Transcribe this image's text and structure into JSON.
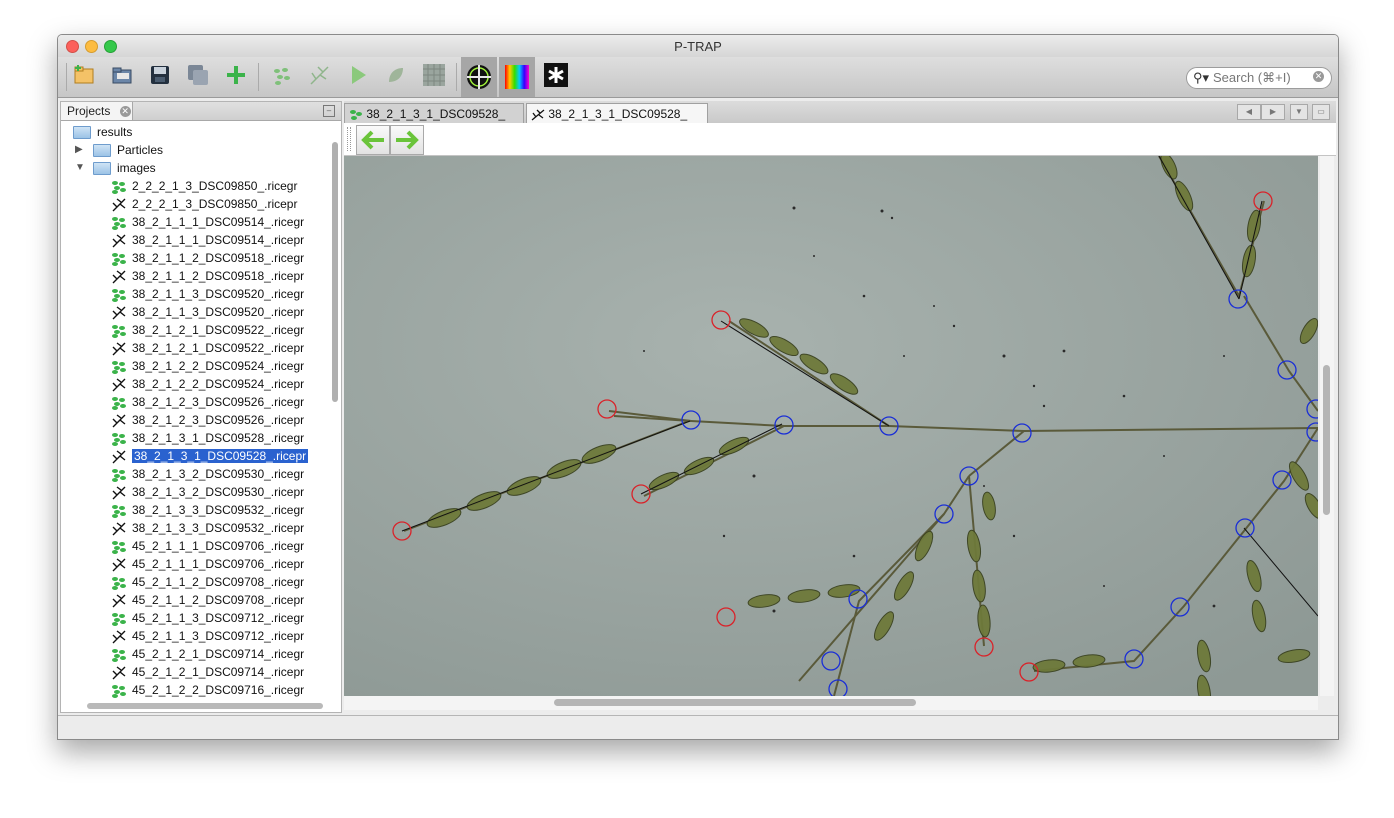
{
  "window": {
    "title": "P-TRAP"
  },
  "toolbar": {
    "buttons": [
      {
        "name": "new-project",
        "icon": "new-project-icon"
      },
      {
        "name": "open-project",
        "icon": "open-folder-icon"
      },
      {
        "name": "save",
        "icon": "save-icon"
      },
      {
        "name": "save-all",
        "icon": "save-all-icon"
      },
      {
        "name": "add",
        "icon": "plus-icon"
      },
      {
        "name": "detect-particles",
        "icon": "particles-icon"
      },
      {
        "name": "detect-skeleton",
        "icon": "skeleton-icon"
      },
      {
        "name": "run",
        "icon": "play-icon"
      },
      {
        "name": "leaf",
        "icon": "leaf-icon"
      },
      {
        "name": "grid",
        "icon": "grid-icon"
      },
      {
        "name": "crosshair",
        "icon": "crosshair-icon",
        "pressed": true
      },
      {
        "name": "color-spectrum",
        "icon": "spectrum-icon",
        "pressed": true
      },
      {
        "name": "asterisk",
        "icon": "asterisk-icon"
      }
    ],
    "search_placeholder": "Search (⌘+I)"
  },
  "left_panel": {
    "tab_label": "Projects",
    "tree": {
      "root": "results",
      "folders": [
        "Particles",
        "images"
      ],
      "files": [
        {
          "name": "2_2_2_1_3_DSC09850_.ricegr",
          "type": "gr"
        },
        {
          "name": "2_2_2_1_3_DSC09850_.ricepr",
          "type": "pr"
        },
        {
          "name": "38_2_1_1_1_DSC09514_.ricegr",
          "type": "gr"
        },
        {
          "name": "38_2_1_1_1_DSC09514_.ricepr",
          "type": "pr"
        },
        {
          "name": "38_2_1_1_2_DSC09518_.ricegr",
          "type": "gr"
        },
        {
          "name": "38_2_1_1_2_DSC09518_.ricepr",
          "type": "pr"
        },
        {
          "name": "38_2_1_1_3_DSC09520_.ricegr",
          "type": "gr"
        },
        {
          "name": "38_2_1_1_3_DSC09520_.ricepr",
          "type": "pr"
        },
        {
          "name": "38_2_1_2_1_DSC09522_.ricegr",
          "type": "gr"
        },
        {
          "name": "38_2_1_2_1_DSC09522_.ricepr",
          "type": "pr"
        },
        {
          "name": "38_2_1_2_2_DSC09524_.ricegr",
          "type": "gr"
        },
        {
          "name": "38_2_1_2_2_DSC09524_.ricepr",
          "type": "pr"
        },
        {
          "name": "38_2_1_2_3_DSC09526_.ricegr",
          "type": "gr"
        },
        {
          "name": "38_2_1_2_3_DSC09526_.ricepr",
          "type": "pr"
        },
        {
          "name": "38_2_1_3_1_DSC09528_.ricegr",
          "type": "gr"
        },
        {
          "name": "38_2_1_3_1_DSC09528_.ricepr",
          "type": "pr",
          "selected": true
        },
        {
          "name": "38_2_1_3_2_DSC09530_.ricegr",
          "type": "gr"
        },
        {
          "name": "38_2_1_3_2_DSC09530_.ricepr",
          "type": "pr"
        },
        {
          "name": "38_2_1_3_3_DSC09532_.ricegr",
          "type": "gr"
        },
        {
          "name": "38_2_1_3_3_DSC09532_.ricepr",
          "type": "pr"
        },
        {
          "name": "45_2_1_1_1_DSC09706_.ricegr",
          "type": "gr"
        },
        {
          "name": "45_2_1_1_1_DSC09706_.ricepr",
          "type": "pr"
        },
        {
          "name": "45_2_1_1_2_DSC09708_.ricegr",
          "type": "gr"
        },
        {
          "name": "45_2_1_1_2_DSC09708_.ricepr",
          "type": "pr"
        },
        {
          "name": "45_2_1_1_3_DSC09712_.ricegr",
          "type": "gr"
        },
        {
          "name": "45_2_1_1_3_DSC09712_.ricepr",
          "type": "pr"
        },
        {
          "name": "45_2_1_2_1_DSC09714_.ricegr",
          "type": "gr"
        },
        {
          "name": "45_2_1_2_1_DSC09714_.ricepr",
          "type": "pr"
        },
        {
          "name": "45_2_1_2_2_DSC09716_.ricegr",
          "type": "gr"
        }
      ]
    }
  },
  "editor": {
    "tabs": [
      {
        "label": "38_2_1_3_1_DSC09528_",
        "icon": "grain-icon",
        "active": false
      },
      {
        "label": "38_2_1_3_1_DSC09528_",
        "icon": "skeleton-icon",
        "active": true
      }
    ],
    "nav_buttons": [
      {
        "name": "back",
        "icon": "arrow-left-icon"
      },
      {
        "name": "forward",
        "icon": "arrow-right-icon"
      }
    ]
  },
  "colors": {
    "grain_green": "#3bb34a",
    "accent_green": "#6ac43a",
    "selection_blue": "#2a62cf",
    "marker_red": "#d9232a",
    "marker_blue": "#1b2fd6",
    "image_bg": "#9aa5a0"
  }
}
